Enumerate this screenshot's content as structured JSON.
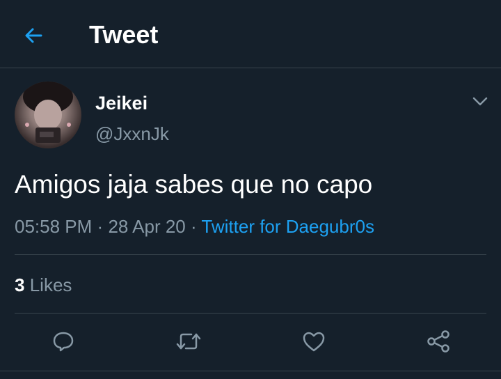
{
  "header": {
    "back_icon": "arrow-left-icon",
    "title": "Tweet"
  },
  "author": {
    "display_name": "Jeikei",
    "handle": "@JxxnJk"
  },
  "tweet": {
    "text": "Amigos jaja sabes que no capo",
    "time": "05:58 PM",
    "separator": "·",
    "date": "28 Apr 20",
    "source": "Twitter for Daegubr0s"
  },
  "stats": {
    "likes_count": "3",
    "likes_label": "Likes"
  },
  "actions": [
    {
      "name": "reply",
      "icon": "reply-icon"
    },
    {
      "name": "retweet",
      "icon": "retweet-icon"
    },
    {
      "name": "like",
      "icon": "heart-icon"
    },
    {
      "name": "share",
      "icon": "share-icon"
    }
  ],
  "colors": {
    "background": "#15202b",
    "accent": "#1da1f2",
    "secondary_text": "#8899a6",
    "divider": "#38444d"
  }
}
